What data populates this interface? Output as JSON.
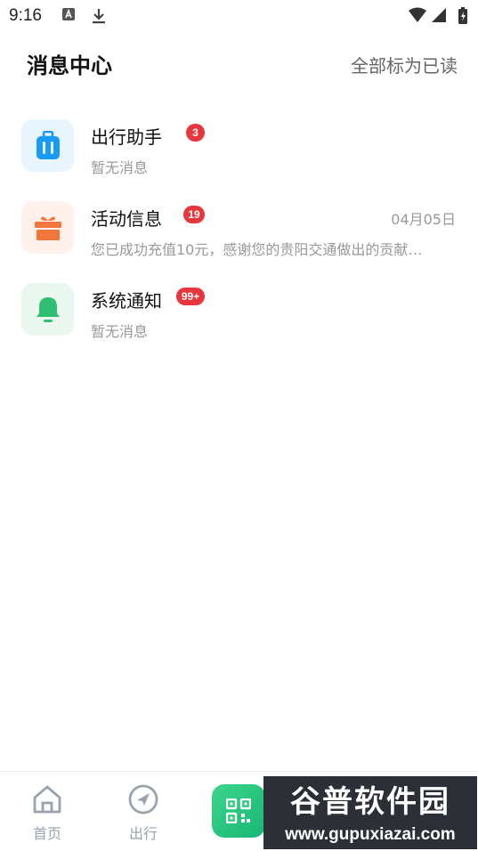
{
  "status_bar": {
    "time": "9:16"
  },
  "header": {
    "title": "消息中心",
    "mark_all_read": "全部标为已读"
  },
  "messages": [
    {
      "title": "出行助手",
      "badge": "3",
      "date": "",
      "preview": "暂无消息",
      "icon": "luggage-icon",
      "icon_color": "#1a9af7",
      "icon_bg": "#e8f4fe"
    },
    {
      "title": "活动信息",
      "badge": "19",
      "date": "04月05日",
      "preview": "您已成功充值10元，感谢您的贵阳交通做出的贡献…",
      "icon": "gift-icon",
      "icon_color": "#f5763c",
      "icon_bg": "#fff1eb"
    },
    {
      "title": "系统通知",
      "badge": "99+",
      "date": "",
      "preview": "暂无消息",
      "icon": "bell-icon",
      "icon_color": "#2fbf71",
      "icon_bg": "#eaf8f0"
    }
  ],
  "bottom_nav": {
    "items": [
      {
        "label": "首页",
        "icon": "home-icon"
      },
      {
        "label": "出行",
        "icon": "compass-icon"
      }
    ],
    "scan_icon": "qr-code-icon"
  },
  "watermark": {
    "line1": "谷普软件园",
    "line2": "www.gupuxiazai.com"
  },
  "colors": {
    "badge": "#e8373c",
    "accent_green": "#16b673",
    "secondary_text": "#999999"
  }
}
